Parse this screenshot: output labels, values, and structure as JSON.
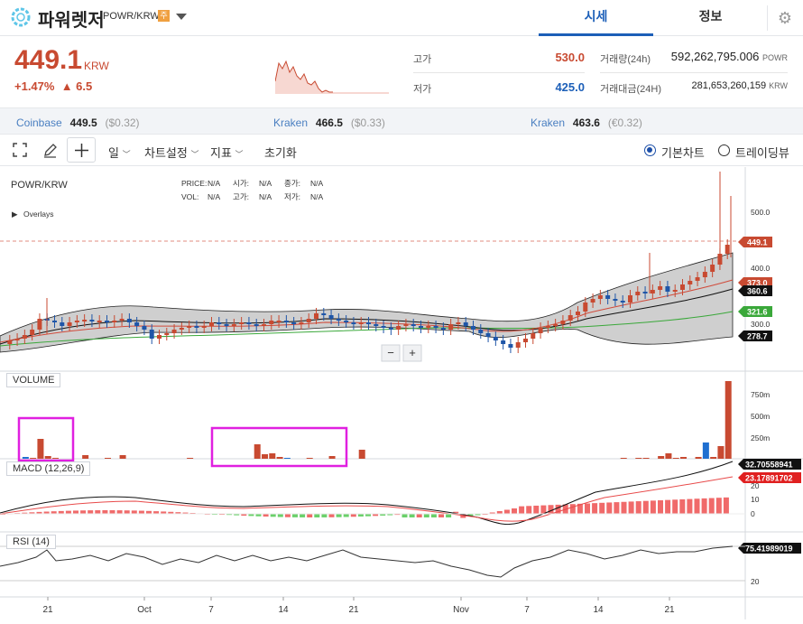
{
  "header": {
    "coin_name": "파워렛저",
    "pair": "POWR/KRW",
    "market_badge": "주",
    "tabs": [
      {
        "label": "시세",
        "active": true
      },
      {
        "label": "정보",
        "active": false
      }
    ]
  },
  "price": {
    "current": "449.1",
    "unit": "KRW",
    "change_pct": "+1.47%",
    "change_abs": "▲ 6.5",
    "color_up": "#c84a31",
    "color_down": "#1c5fb8"
  },
  "stats": {
    "high_label": "고가",
    "high_value": "530.0",
    "low_label": "저가",
    "low_value": "425.0",
    "volume_label": "거래량(24h)",
    "volume_value": "592,262,795.006",
    "volume_unit": "POWR",
    "amount_label": "거래대금(24H)",
    "amount_value": "281,653,260,159",
    "amount_unit": "KRW"
  },
  "exchanges": [
    {
      "name": "Coinbase",
      "price": "449.5",
      "ref": "($0.32)"
    },
    {
      "name": "Kraken",
      "price": "466.5",
      "ref": "($0.33)"
    },
    {
      "name": "Kraken",
      "price": "463.6",
      "ref": "(€0.32)"
    }
  ],
  "toolbar": {
    "period": "일",
    "chart_settings": "차트설정",
    "indicators": "지표",
    "reset": "초기화",
    "view_basic": "기본차트",
    "view_trading": "트레이딩뷰"
  },
  "chart": {
    "symbol": "POWR/KRW",
    "overlays_label": "Overlays",
    "info_labels": {
      "price": "PRICE:",
      "vol": "VOL:",
      "open": "시가:",
      "high": "고가:",
      "close": "종가:",
      "low": "저가:",
      "na": "N/A"
    },
    "zoom_out": "−",
    "zoom_in": "+",
    "price_axis_ticks": [
      "500.0",
      "400.0",
      "300.0"
    ],
    "price_tags": [
      {
        "value": "449.1",
        "color": "#c84a31"
      },
      {
        "value": "373.0",
        "color": "#c84a31"
      },
      {
        "value": "360.6",
        "color": "#111111"
      },
      {
        "value": "321.6",
        "color": "#3aa83a"
      },
      {
        "value": "278.7",
        "color": "#111111"
      }
    ],
    "volume_label": "VOLUME",
    "volume_ticks": [
      "750m",
      "500m",
      "250m"
    ],
    "macd_label": "MACD (12,26,9)",
    "macd_ticks": [
      "20",
      "10",
      "0"
    ],
    "macd_tags": [
      {
        "value": "32.70558941",
        "color": "#111111"
      },
      {
        "value": "23.17891702",
        "color": "#e02020"
      }
    ],
    "rsi_label": "RSI (14)",
    "rsi_ticks": [
      "20"
    ],
    "rsi_tag": {
      "value": "75.41989019",
      "color": "#111111"
    },
    "x_ticks": [
      "21",
      "Oct",
      "7",
      "14",
      "21",
      "Nov",
      "7",
      "14",
      "21"
    ]
  }
}
